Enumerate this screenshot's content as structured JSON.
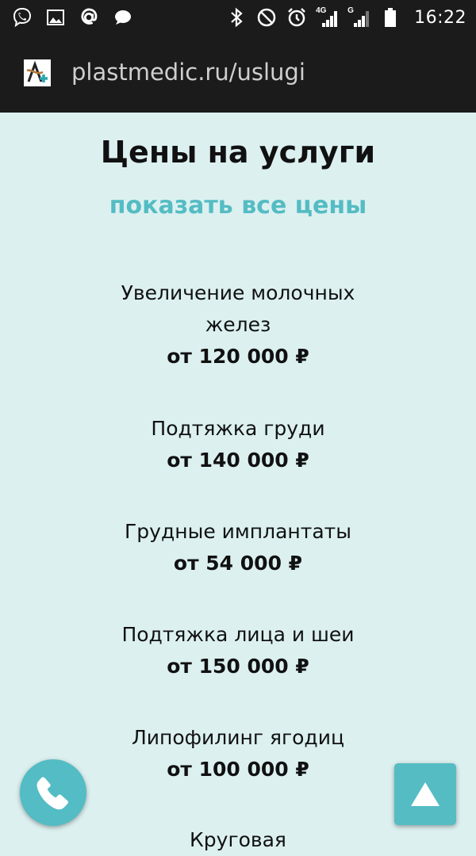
{
  "status_bar": {
    "time": "16:22",
    "network_4g": "4G",
    "network_g": "G",
    "icons_left": [
      "viber-icon",
      "image-icon",
      "at-icon",
      "chat-icon"
    ],
    "icons_right": [
      "bluetooth-icon",
      "do-not-disturb-icon",
      "alarm-icon",
      "signal-4g-icon",
      "signal-g-icon",
      "battery-icon"
    ]
  },
  "browser": {
    "url": "plastmedic.ru/uslugi"
  },
  "page": {
    "title": "Цены на услуги",
    "show_all_label": "показать все цены",
    "services": [
      {
        "name": "Увеличение молочных желез",
        "price": "от 120 000 ₽"
      },
      {
        "name": "Подтяжка груди",
        "price": "от 140 000 ₽"
      },
      {
        "name": "Грудные имплантаты",
        "price": "от 54 000 ₽"
      },
      {
        "name": "Подтяжка лица и шеи",
        "price": "от 150 000 ₽"
      },
      {
        "name": "Липофилинг ягодиц",
        "price": "от 100 000 ₽"
      },
      {
        "name": "Круговая",
        "price": ""
      }
    ]
  },
  "colors": {
    "accent": "#54bcc3",
    "background": "#dcf0f0",
    "bar": "#1b1b1b"
  }
}
